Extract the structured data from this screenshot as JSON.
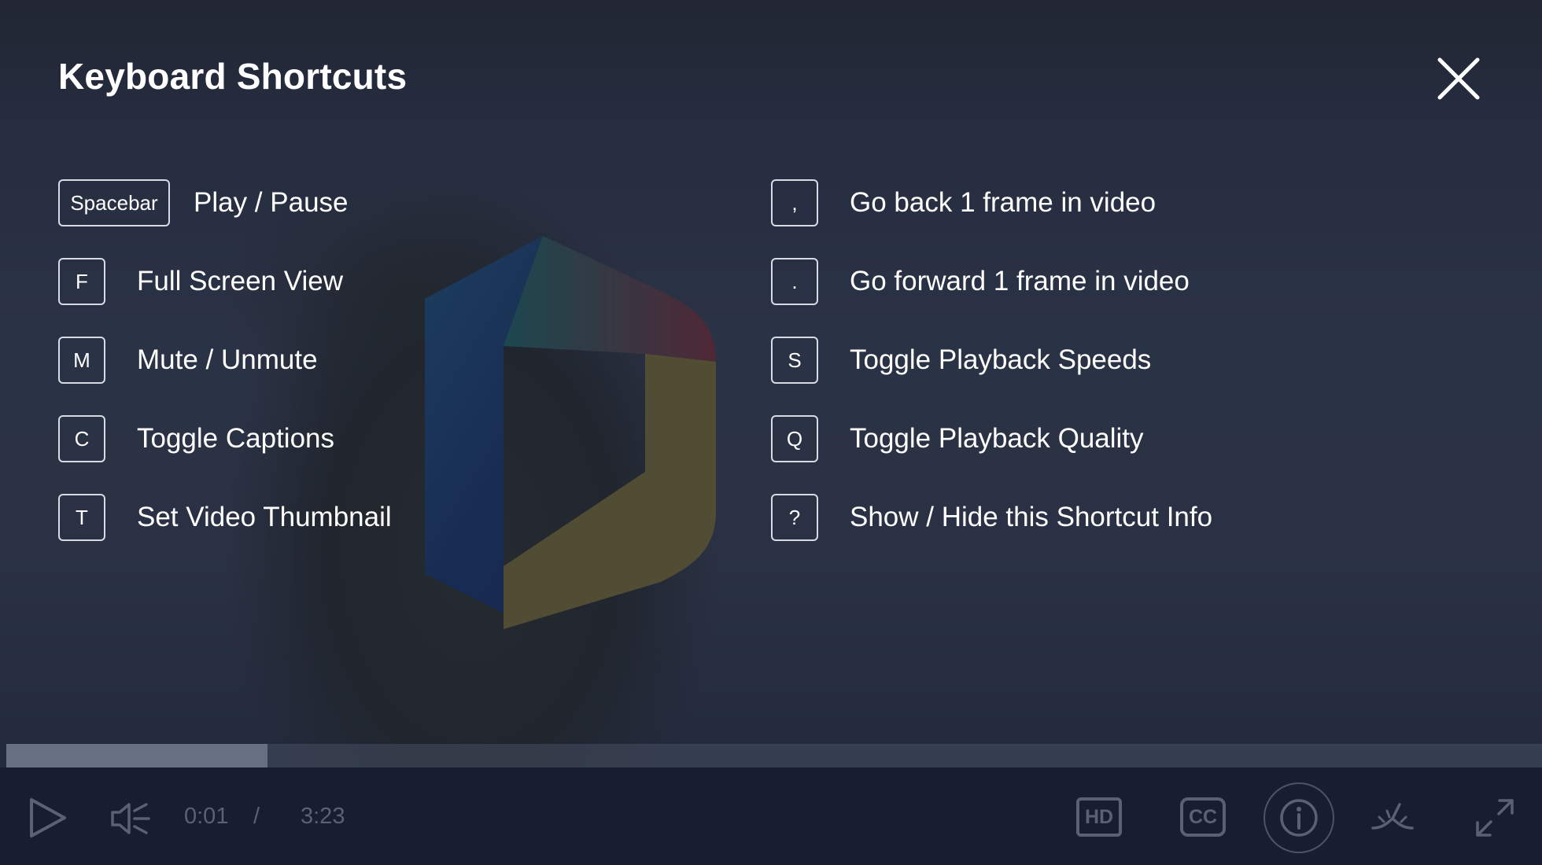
{
  "dialog": {
    "title": "Keyboard Shortcuts"
  },
  "shortcuts": {
    "left": [
      {
        "key": "Spacebar",
        "label": "Play / Pause"
      },
      {
        "key": "F",
        "label": "Full Screen View"
      },
      {
        "key": "M",
        "label": "Mute / Unmute"
      },
      {
        "key": "C",
        "label": "Toggle Captions"
      },
      {
        "key": "T",
        "label": "Set Video Thumbnail"
      }
    ],
    "right": [
      {
        "key": ",",
        "label": "Go back 1 frame in video"
      },
      {
        "key": ".",
        "label": "Go forward 1 frame in video"
      },
      {
        "key": "S",
        "label": "Toggle Playback Speeds"
      },
      {
        "key": "Q",
        "label": "Toggle Playback Quality"
      },
      {
        "key": "?",
        "label": "Show / Hide this Shortcut Info"
      }
    ]
  },
  "player": {
    "current_time": "0:01",
    "separator": "/",
    "duration": "3:23",
    "progress_fraction": 0.17,
    "hd_label": "HD",
    "cc_label": "CC"
  },
  "icons": {
    "close": "close-icon",
    "play": "play-icon",
    "volume": "volume-icon",
    "quality": "hd-icon",
    "captions": "cc-icon",
    "info": "info-icon",
    "thumbnail": "set-thumbnail-icon",
    "fullscreen": "fullscreen-icon"
  },
  "colors": {
    "overlay": "#181e32",
    "text": "#ffffff",
    "muted_control": "#5a6174"
  }
}
